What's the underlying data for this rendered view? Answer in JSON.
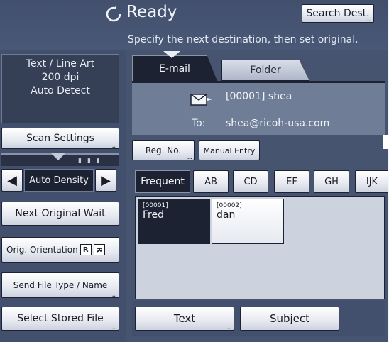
{
  "header": {
    "status": "Ready",
    "subtitle": "Specify the next destination, then set original.",
    "search_button": "Search Dest."
  },
  "scan_info": {
    "line1": "Text / Line Art",
    "line2": "200 dpi",
    "line3": "Auto Detect"
  },
  "left_buttons": {
    "scan_settings": "Scan Settings",
    "density": "Auto Density",
    "next_original": "Next Original Wait",
    "orientation": "Orig. Orientation",
    "file_type": "Send File Type / Name",
    "stored_file": "Select Stored File"
  },
  "tabs": {
    "email": "E-mail",
    "folder": "Folder"
  },
  "destination": {
    "name": "[00001] shea",
    "to_label": "To:",
    "address": "shea@ricoh-usa.com"
  },
  "entry_buttons": {
    "reg_no": "Reg. No.",
    "manual": "Manual Entry"
  },
  "index_tabs": [
    "Frequent",
    "AB",
    "CD",
    "EF",
    "GH",
    "IJK"
  ],
  "dest_list": [
    {
      "num": "[00001]",
      "name": "Fred"
    },
    {
      "num": "[00002]",
      "name": "dan"
    }
  ],
  "bottom": {
    "text": "Text",
    "subject": "Subject"
  },
  "icons": {
    "status": "refresh-icon",
    "dest": "envelope-icon"
  }
}
